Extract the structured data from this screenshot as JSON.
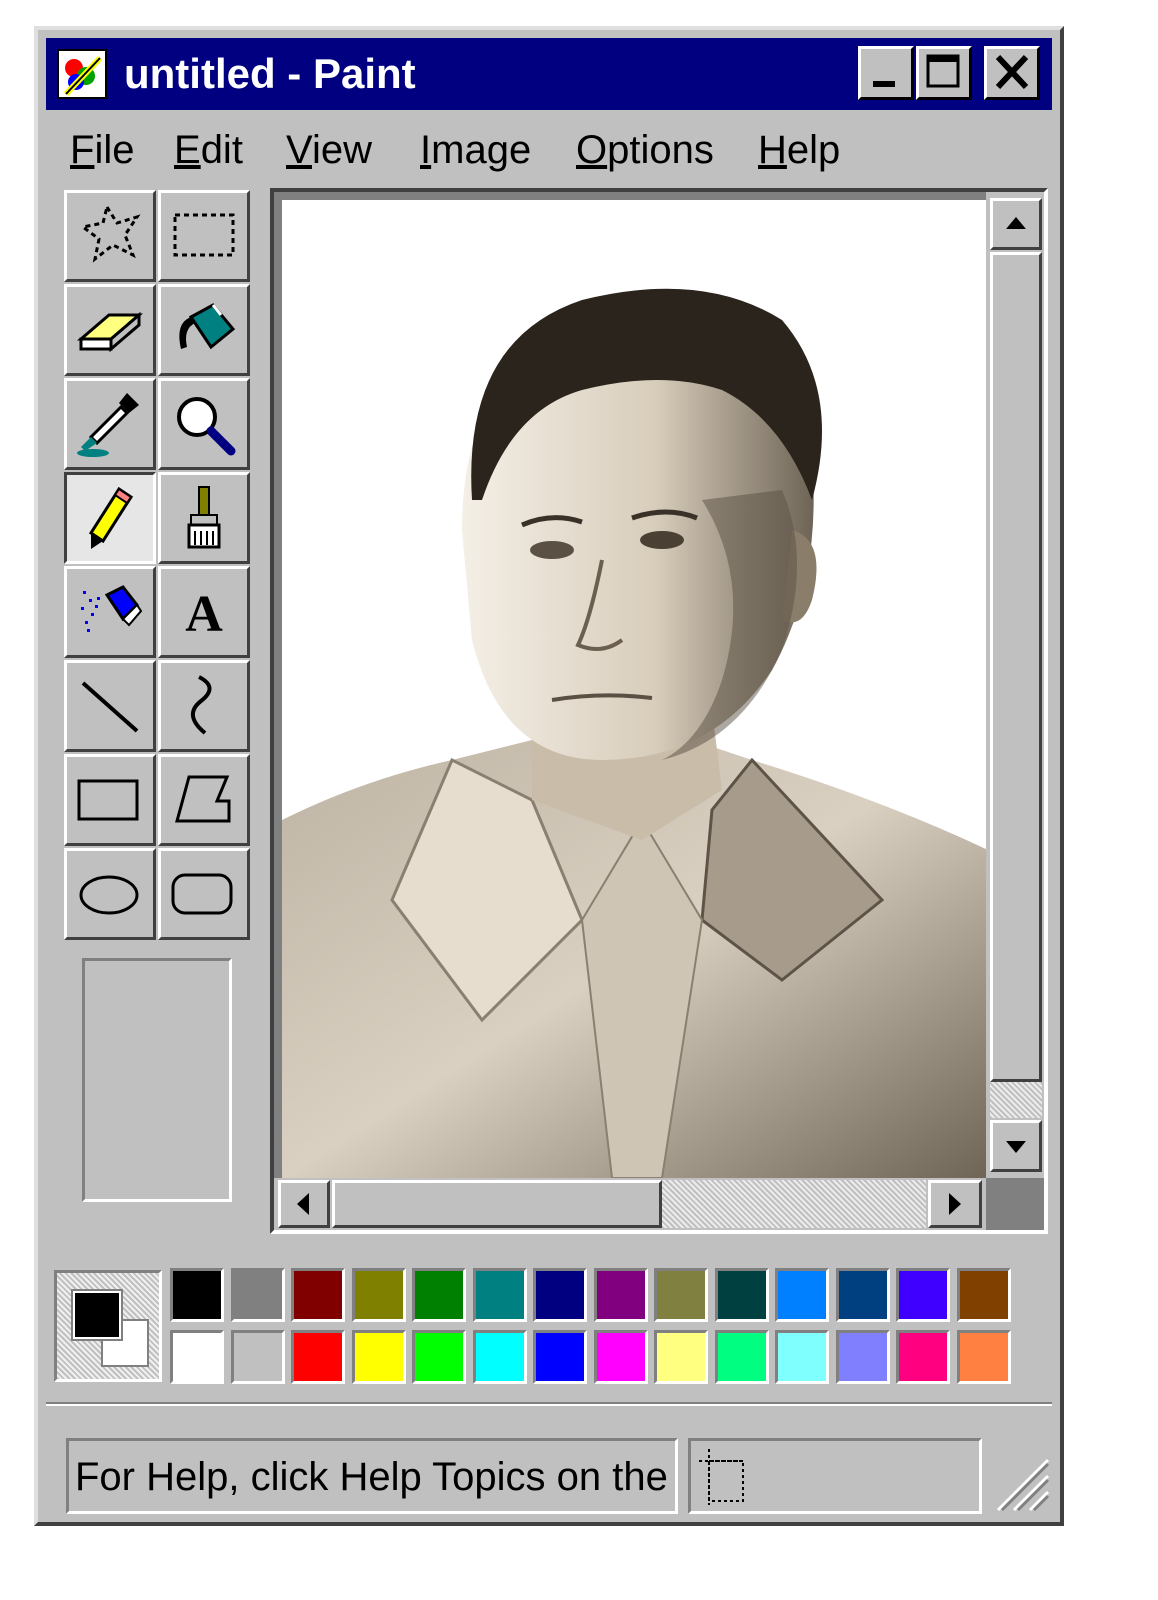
{
  "window": {
    "title": "untitled - Paint",
    "app_icon": "paint-app-icon",
    "controls": [
      "minimize-icon",
      "maximize-icon",
      "close-icon"
    ]
  },
  "menu": {
    "items": [
      {
        "label": "File",
        "mnemonic": "F",
        "rest": "ile"
      },
      {
        "label": "Edit",
        "mnemonic": "E",
        "rest": "dit"
      },
      {
        "label": "View",
        "mnemonic": "V",
        "rest": "iew"
      },
      {
        "label": "Image",
        "mnemonic": "I",
        "rest": "mage"
      },
      {
        "label": "Options",
        "mnemonic": "O",
        "rest": "ptions"
      },
      {
        "label": "Help",
        "mnemonic": "H",
        "rest": "elp"
      }
    ]
  },
  "tools": [
    {
      "name": "free-form-select",
      "icon": "free-form-select-icon"
    },
    {
      "name": "rectangle-select",
      "icon": "rectangle-select-icon"
    },
    {
      "name": "eraser",
      "icon": "eraser-icon"
    },
    {
      "name": "fill-with-color",
      "icon": "paint-bucket-icon"
    },
    {
      "name": "pick-color",
      "icon": "eyedropper-icon"
    },
    {
      "name": "magnifier",
      "icon": "magnifier-icon"
    },
    {
      "name": "pencil",
      "icon": "pencil-icon",
      "selected": true
    },
    {
      "name": "brush",
      "icon": "brush-icon"
    },
    {
      "name": "airbrush",
      "icon": "airbrush-icon"
    },
    {
      "name": "text",
      "icon": "text-icon",
      "glyph": "A"
    },
    {
      "name": "line",
      "icon": "line-icon"
    },
    {
      "name": "curve",
      "icon": "curve-icon"
    },
    {
      "name": "rectangle",
      "icon": "rectangle-icon"
    },
    {
      "name": "polygon",
      "icon": "polygon-icon"
    },
    {
      "name": "ellipse",
      "icon": "ellipse-icon"
    },
    {
      "name": "rounded-rectangle",
      "icon": "rounded-rectangle-icon"
    }
  ],
  "canvas": {
    "content": "black-and-white portrait photograph"
  },
  "colors": {
    "foreground": "#000000",
    "background": "#ffffff",
    "palette_top": [
      "#000000",
      "#808080",
      "#800000",
      "#808000",
      "#008000",
      "#008080",
      "#000080",
      "#800080",
      "#808040",
      "#004040",
      "#0080ff",
      "#004080",
      "#4000ff",
      "#804000"
    ],
    "palette_bottom": [
      "#ffffff",
      "#c0c0c0",
      "#ff0000",
      "#ffff00",
      "#00ff00",
      "#00ffff",
      "#0000ff",
      "#ff00ff",
      "#ffff80",
      "#00ff80",
      "#80ffff",
      "#8080ff",
      "#ff0080",
      "#ff8040"
    ]
  },
  "statusbar": {
    "help_text": "For Help, click Help Topics on the",
    "coord_icon": "selection-size-icon"
  }
}
